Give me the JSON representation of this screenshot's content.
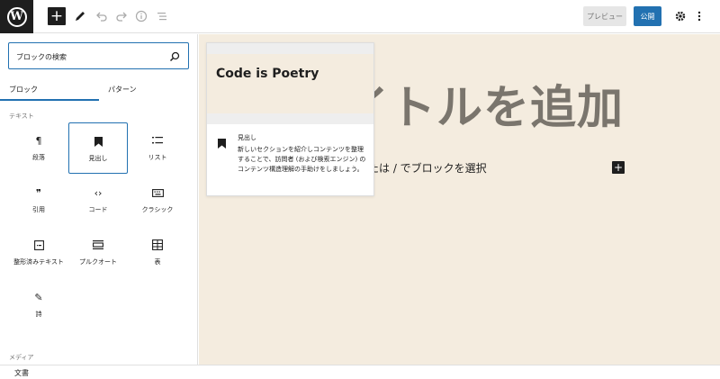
{
  "toolbar": {
    "logo_letter": "W",
    "add_glyph": "+",
    "preview_label": "プレビュー",
    "publish_label": "公開"
  },
  "inserter": {
    "search_placeholder": "ブロックの検索",
    "tabs": [
      {
        "label": "ブロック",
        "active": true
      },
      {
        "label": "パターン",
        "active": false
      }
    ],
    "category_text": "テキスト",
    "category_media": "メディア",
    "blocks": [
      {
        "label": "段落",
        "icon": "paragraph-icon",
        "glyph": "¶"
      },
      {
        "label": "見出し",
        "icon": "bookmark-icon",
        "glyph": "",
        "selected": true
      },
      {
        "label": "リスト",
        "icon": "list-icon",
        "glyph": "☰"
      },
      {
        "label": "引用",
        "icon": "quote-icon",
        "glyph": "❞"
      },
      {
        "label": "コード",
        "icon": "code-icon",
        "glyph": "‹›"
      },
      {
        "label": "クラシック",
        "icon": "keyboard-icon",
        "glyph": "⌨"
      },
      {
        "label": "整形済みテキスト",
        "icon": "preformatted-icon",
        "glyph": "▭"
      },
      {
        "label": "プルクオート",
        "icon": "pullquote-icon",
        "glyph": "▭"
      },
      {
        "label": "表",
        "icon": "table-icon",
        "glyph": "▦"
      },
      {
        "label": "詩",
        "icon": "feather-icon",
        "glyph": "✎"
      }
    ]
  },
  "canvas": {
    "title_placeholder": "イトルを追加",
    "block_prompt": "または / でブロックを選択",
    "inline_add_glyph": "+"
  },
  "preview": {
    "heading": "Code is Poetry",
    "block_name": "見出し",
    "description": "新しいセクションを紹介しコンテンツを整理することで、訪問者 (および検索エンジン) のコンテンツ構造理解の手助けをしましょう。"
  },
  "footer": {
    "breadcrumb": "文書"
  },
  "colors": {
    "accent": "#2271b1",
    "canvas_bg": "#f4ecdf",
    "dark": "#1e1e1e"
  }
}
